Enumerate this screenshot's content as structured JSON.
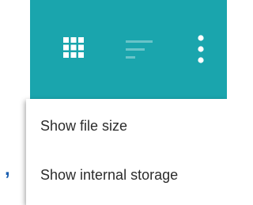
{
  "toolbar": {
    "background_color": "#1aa5ad",
    "icons": {
      "grid": "grid-view-icon",
      "sort": "sort-icon",
      "more": "more-vert-icon"
    }
  },
  "menu": {
    "items": [
      {
        "label": "Show file size"
      },
      {
        "label": "Show internal storage"
      }
    ]
  },
  "background_fragment": {
    "text": ","
  }
}
